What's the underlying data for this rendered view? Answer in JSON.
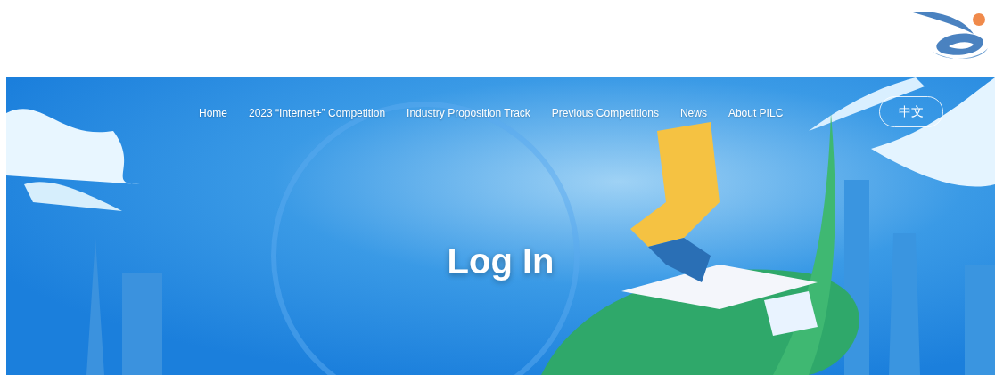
{
  "nav": [
    {
      "label": "Home"
    },
    {
      "label": "2023 “Internet+” Competition"
    },
    {
      "label": "Industry Proposition Track"
    },
    {
      "label": "Previous Competitions"
    },
    {
      "label": "News"
    },
    {
      "label": "About PILC"
    }
  ],
  "language_button": "中文",
  "banner": {
    "title": "Log In"
  }
}
